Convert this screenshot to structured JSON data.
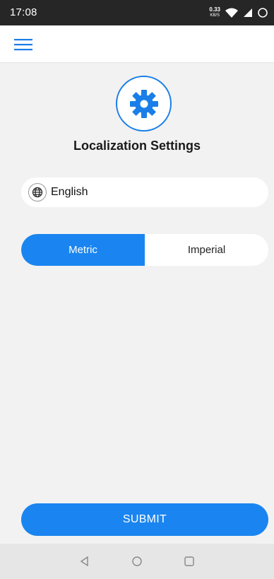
{
  "status_bar": {
    "time": "17:08",
    "speed_value": "0.33",
    "speed_unit": "KB/S",
    "icons": [
      "wifi-icon",
      "signal-icon",
      "battery-icon"
    ]
  },
  "app_bar": {
    "menu_icon": "hamburger-menu-icon"
  },
  "settings": {
    "icon": "gear-icon",
    "title": "Localization Settings",
    "language": {
      "icon": "globe-icon",
      "value": "English"
    },
    "units": {
      "options": [
        "Metric",
        "Imperial"
      ],
      "selected": "Metric"
    },
    "submit_label": "SUBMIT"
  },
  "nav_bar": {
    "buttons": [
      "back-icon",
      "home-icon",
      "recents-icon"
    ]
  },
  "colors": {
    "accent": "#1a85f0",
    "background": "#f2f2f2",
    "status_bar": "#262626"
  }
}
